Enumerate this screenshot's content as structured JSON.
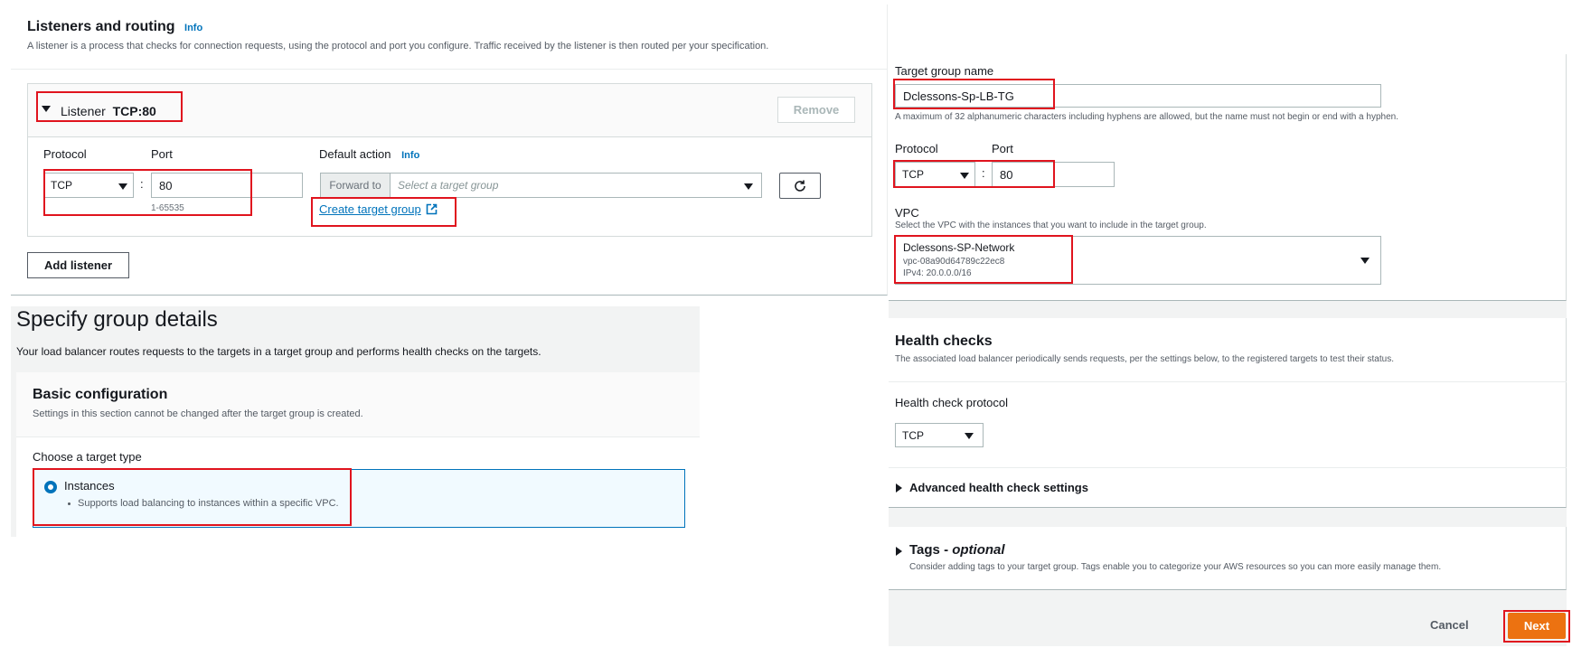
{
  "listeners": {
    "title": "Listeners and routing",
    "info": "Info",
    "description": "A listener is a process that checks for connection requests, using the protocol and port you configure. Traffic received by the listener is then routed per your specification.",
    "listener_prefix": "Listener",
    "listener_value": "TCP:80",
    "remove_label": "Remove",
    "protocol_label": "Protocol",
    "protocol_value": "TCP",
    "port_label": "Port",
    "port_value": "80",
    "port_hint": "1-65535",
    "default_action_label": "Default action",
    "default_action_info": "Info",
    "forward_to": "Forward to",
    "target_group_placeholder": "Select a target group",
    "create_target_group": "Create target group",
    "add_listener": "Add listener",
    "separator": ":"
  },
  "group_details": {
    "title": "Specify group details",
    "description": "Your load balancer routes requests to the targets in a target group and performs health checks on the targets.",
    "basic_title": "Basic configuration",
    "basic_desc": "Settings in this section cannot be changed after the target group is created.",
    "choose_label": "Choose a target type",
    "instances_label": "Instances",
    "instances_desc": "Supports load balancing to instances within a specific VPC."
  },
  "target_group": {
    "name_label": "Target group name",
    "name_value": "Dclessons-Sp-LB-TG",
    "name_hint": "A maximum of 32 alphanumeric characters including hyphens are allowed, but the name must not begin or end with a hyphen.",
    "protocol_label": "Protocol",
    "protocol_value": "TCP",
    "port_label": "Port",
    "port_value": "80",
    "separator": ":",
    "vpc_label": "VPC",
    "vpc_desc": "Select the VPC with the instances that you want to include in the target group.",
    "vpc_name": "Dclessons-SP-Network",
    "vpc_id": "vpc-08a90d64789c22ec8",
    "vpc_cidr": "IPv4: 20.0.0.0/16"
  },
  "health_checks": {
    "title": "Health checks",
    "description": "The associated load balancer periodically sends requests, per the settings below, to the registered targets to test their status.",
    "protocol_label": "Health check protocol",
    "protocol_value": "TCP",
    "advanced_label": "Advanced health check settings"
  },
  "tags": {
    "title_prefix": "Tags - ",
    "title_optional": "optional",
    "description": "Consider adding tags to your target group. Tags enable you to categorize your AWS resources so you can more easily manage them."
  },
  "footer": {
    "cancel": "Cancel",
    "next": "Next"
  },
  "colors": {
    "accent": "#0073bb",
    "primary_button": "#ec7211",
    "highlight": "#e0141e"
  }
}
